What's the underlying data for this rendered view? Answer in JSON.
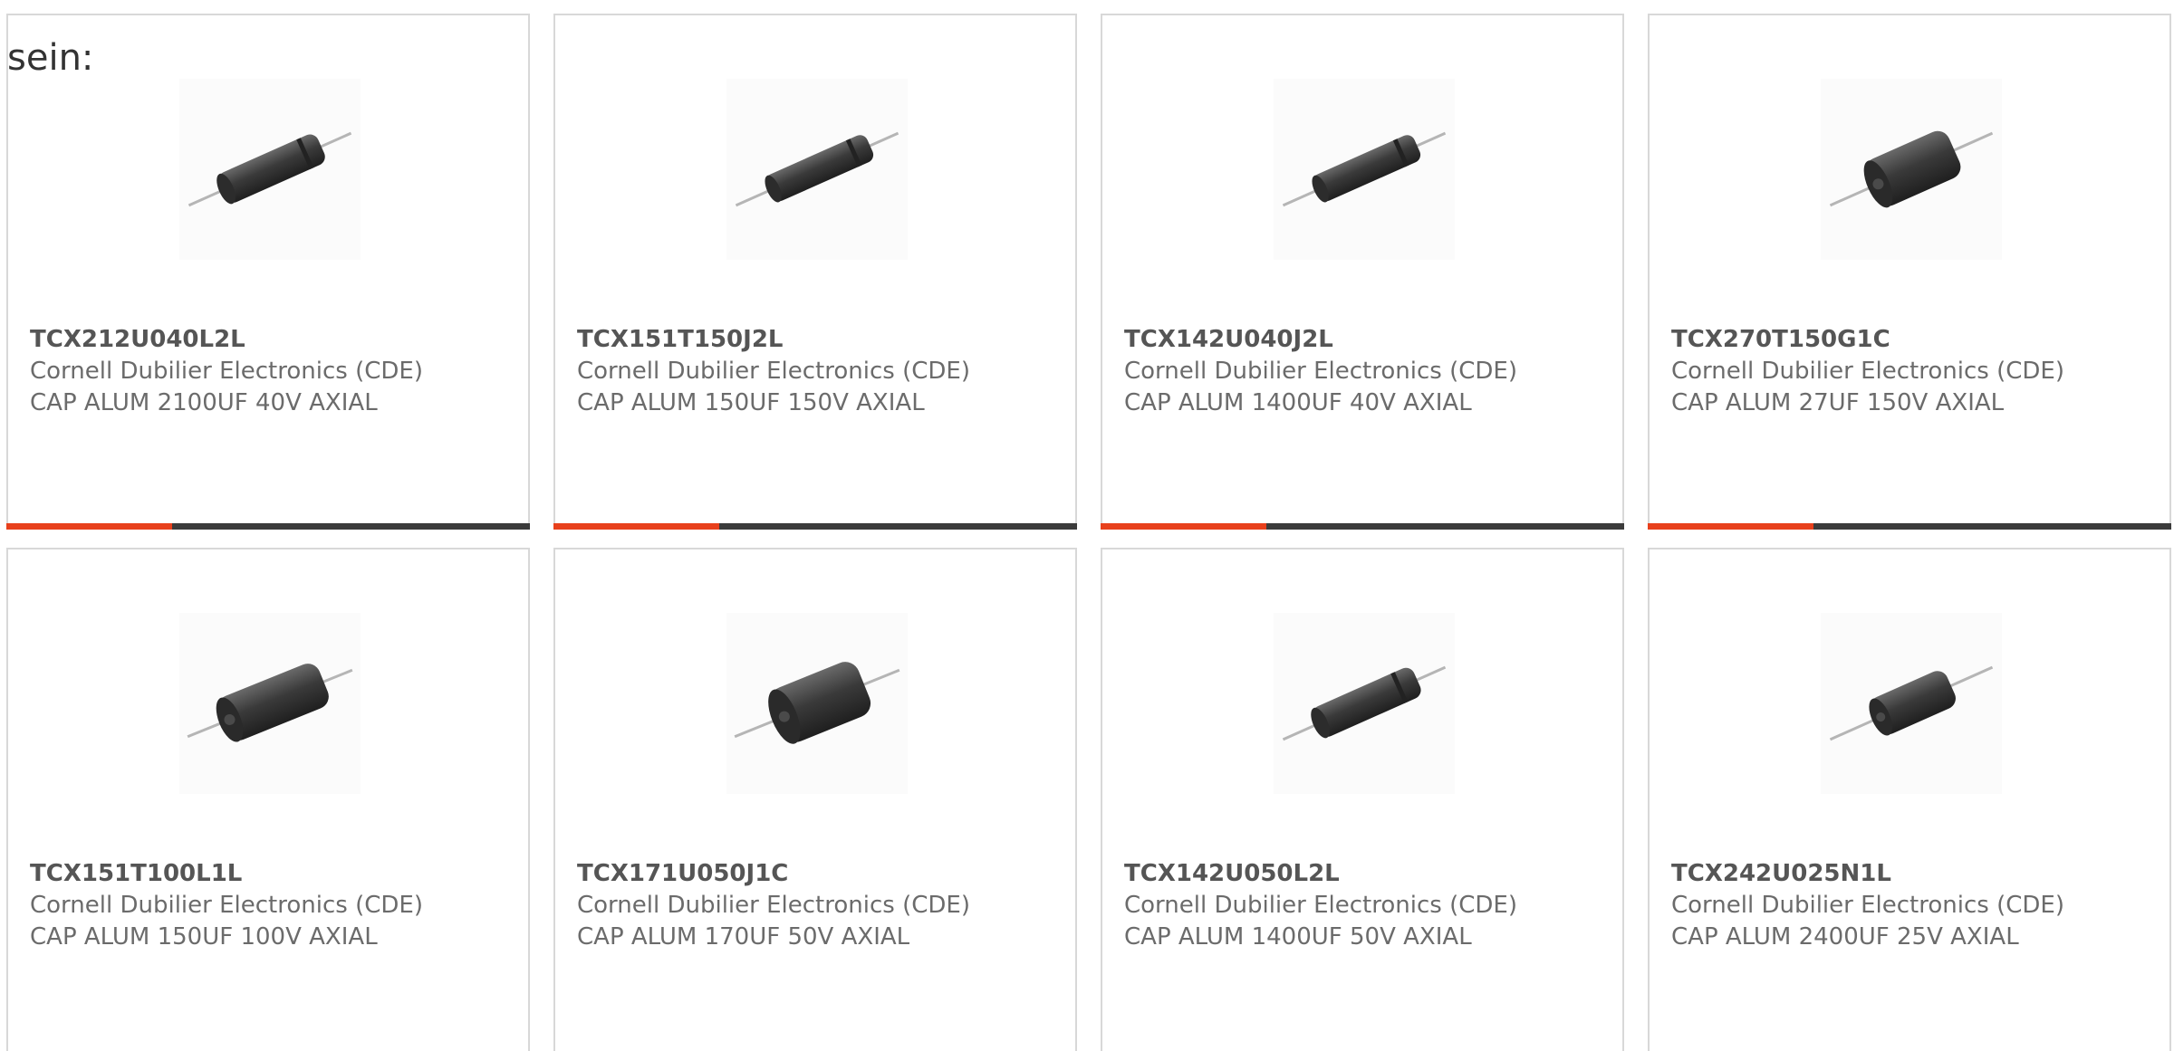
{
  "page": {
    "lead_text": "sein:",
    "accent_color": "#e8401c",
    "bar_color": "#3b3b3b"
  },
  "products": [
    {
      "part": "TCX212U040L2L",
      "maker": "Cornell Dubilier Electronics (CDE)",
      "desc": "CAP ALUM 2100UF 40V AXIAL",
      "image_icon": "capacitor-slim-icon"
    },
    {
      "part": "TCX151T150J2L",
      "maker": "Cornell Dubilier Electronics (CDE)",
      "desc": "CAP ALUM 150UF 150V AXIAL",
      "image_icon": "capacitor-slim-icon"
    },
    {
      "part": "TCX142U040J2L",
      "maker": "Cornell Dubilier Electronics (CDE)",
      "desc": "CAP ALUM 1400UF 40V AXIAL",
      "image_icon": "capacitor-slim-icon"
    },
    {
      "part": "TCX270T150G1C",
      "maker": "Cornell Dubilier Electronics (CDE)",
      "desc": "CAP ALUM 27UF 150V AXIAL",
      "image_icon": "capacitor-short-icon"
    },
    {
      "part": "TCX151T100L1L",
      "maker": "Cornell Dubilier Electronics (CDE)",
      "desc": "CAP ALUM 150UF 100V AXIAL",
      "image_icon": "capacitor-short-icon"
    },
    {
      "part": "TCX171U050J1C",
      "maker": "Cornell Dubilier Electronics (CDE)",
      "desc": "CAP ALUM 170UF 50V AXIAL",
      "image_icon": "capacitor-short-icon"
    },
    {
      "part": "TCX142U050L2L",
      "maker": "Cornell Dubilier Electronics (CDE)",
      "desc": "CAP ALUM 1400UF 50V AXIAL",
      "image_icon": "capacitor-slim-icon"
    },
    {
      "part": "TCX242U025N1L",
      "maker": "Cornell Dubilier Electronics (CDE)",
      "desc": "CAP ALUM 2400UF 25V AXIAL",
      "image_icon": "capacitor-short-icon"
    }
  ]
}
